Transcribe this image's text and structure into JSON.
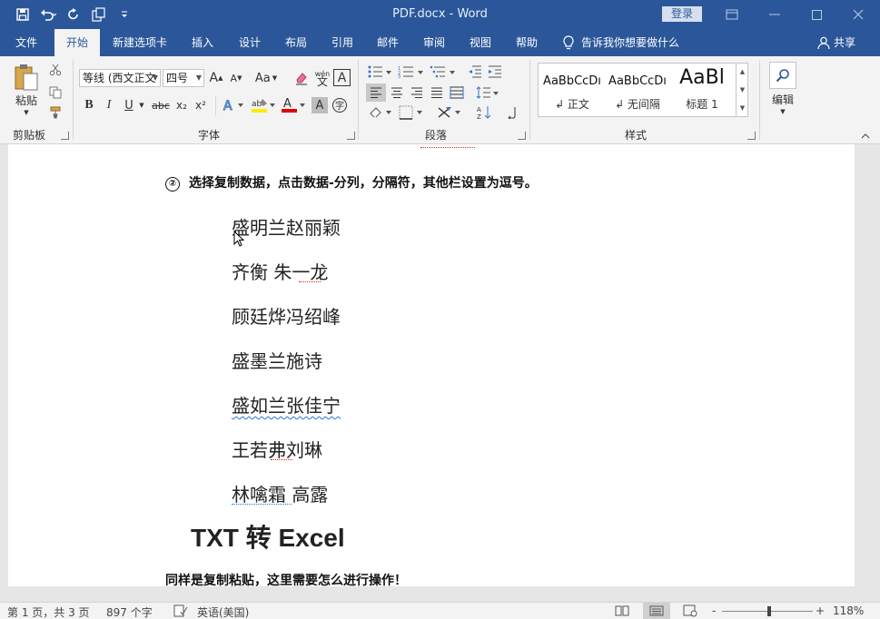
{
  "window": {
    "title": "PDF.docx  -  Word",
    "login_label": "登录"
  },
  "tabs": [
    {
      "label": "文件"
    },
    {
      "label": "开始"
    },
    {
      "label": "新建选项卡"
    },
    {
      "label": "插入"
    },
    {
      "label": "设计"
    },
    {
      "label": "布局"
    },
    {
      "label": "引用"
    },
    {
      "label": "邮件"
    },
    {
      "label": "审阅"
    },
    {
      "label": "视图"
    },
    {
      "label": "帮助"
    }
  ],
  "tell_me": "告诉我你想要做什么",
  "share_label": "共享",
  "ribbon": {
    "clipboard": {
      "paste_label": "粘贴",
      "group_label": "剪贴板"
    },
    "font": {
      "font_name": "等线 (西文正文",
      "font_size": "四号",
      "grow": "A",
      "shrink": "A",
      "case": "Aa",
      "wen": "wén\n文",
      "bold": "B",
      "italic": "I",
      "underline": "U",
      "strike": "abc",
      "subscript": "x₂",
      "superscript": "x²",
      "group_label": "字体"
    },
    "paragraph": {
      "group_label": "段落"
    },
    "styles": {
      "items": [
        {
          "sample": "AaBbCcDı",
          "name": "↲ 正文"
        },
        {
          "sample": "AaBbCcDı",
          "name": "↲ 无间隔"
        },
        {
          "sample": "AaBl",
          "name": "标题 1"
        }
      ],
      "group_label": "样式"
    },
    "editing": {
      "label": "编辑"
    }
  },
  "document": {
    "step_marker": "②",
    "step_text": "选择复制数据，点击数据-分列，分隔符，其他栏设置为逗号。",
    "names": [
      "盛明兰赵丽颖",
      "齐衡  朱一龙",
      "顾廷烨冯绍峰",
      "盛墨兰施诗",
      "盛如兰张佳宁",
      "王若弗刘琳",
      "林噙霜  高露"
    ],
    "heading": "TXT 转 Excel",
    "paragraph": "同样是复制粘贴，这里需要怎么进行操作！"
  },
  "status": {
    "page": "第 1 页，共 3 页",
    "words": "897 个字",
    "language": "英语(美国)",
    "zoom_minus": "-",
    "zoom_plus": "+",
    "zoom": "118%"
  },
  "colors": {
    "accent": "#2b579a",
    "ribbon_bg": "#f3f3f3",
    "spell_red": "#e02020",
    "grammar_blue": "#2b6fd6"
  }
}
